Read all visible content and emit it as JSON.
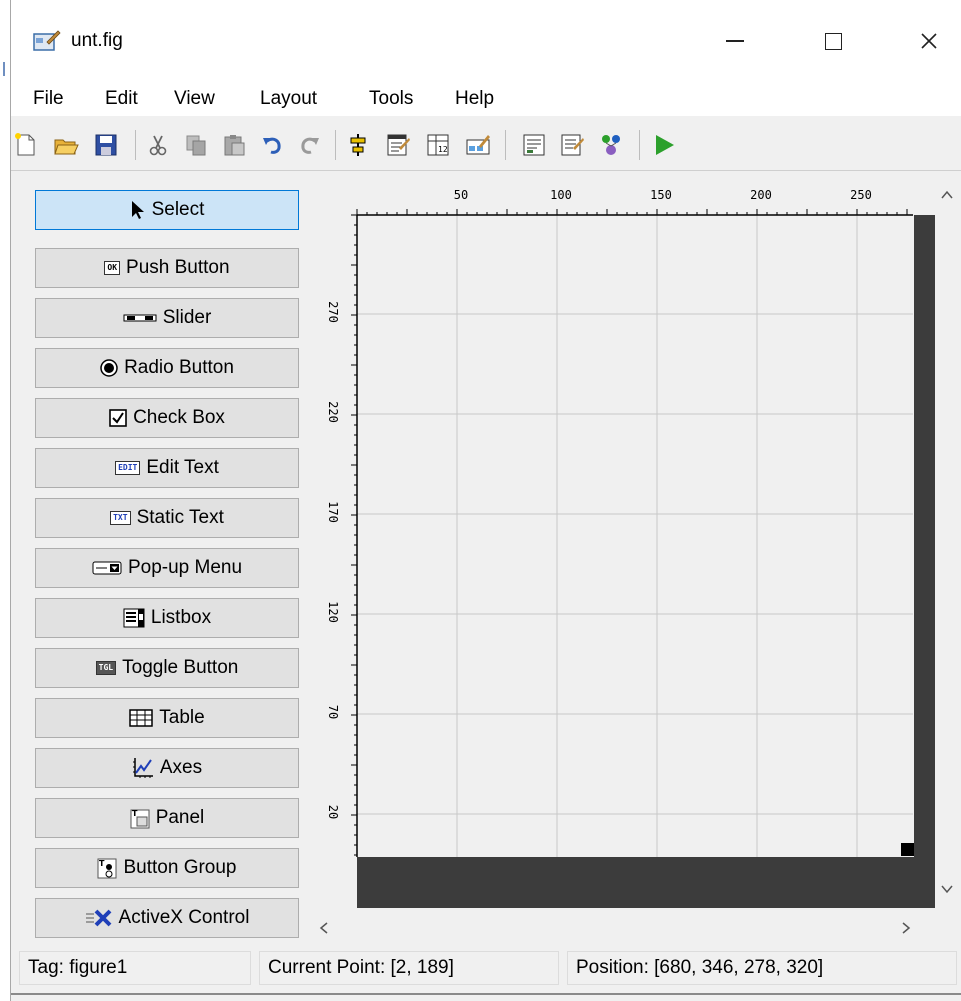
{
  "window": {
    "title": "unt.fig"
  },
  "menu": [
    "File",
    "Edit",
    "View",
    "Layout",
    "Tools",
    "Help"
  ],
  "toolbar": [
    "new-file-icon",
    "open-folder-icon",
    "save-icon",
    "cut-icon",
    "copy-icon",
    "paste-icon",
    "undo-icon",
    "redo-icon",
    "align-objects-icon",
    "menu-editor-icon",
    "tab-order-editor-icon",
    "toolbar-editor-icon",
    "editor-icon",
    "property-inspector-icon",
    "object-browser-icon",
    "run-figure-icon"
  ],
  "palette": {
    "selected": "Select",
    "items": [
      {
        "label": "Select",
        "icon": "arrow-cursor-icon"
      },
      {
        "label": "Push Button",
        "icon": "push-button-icon",
        "glyph": "OK"
      },
      {
        "label": "Slider",
        "icon": "slider-icon"
      },
      {
        "label": "Radio Button",
        "icon": "radio-button-icon"
      },
      {
        "label": "Check Box",
        "icon": "check-box-icon"
      },
      {
        "label": "Edit Text",
        "icon": "edit-text-icon",
        "glyph": "EDIT"
      },
      {
        "label": "Static Text",
        "icon": "static-text-icon",
        "glyph": "TXT"
      },
      {
        "label": "Pop-up Menu",
        "icon": "popup-menu-icon"
      },
      {
        "label": "Listbox",
        "icon": "listbox-icon"
      },
      {
        "label": "Toggle Button",
        "icon": "toggle-button-icon",
        "glyph": "TGL"
      },
      {
        "label": "Table",
        "icon": "table-icon"
      },
      {
        "label": "Axes",
        "icon": "axes-icon"
      },
      {
        "label": "Panel",
        "icon": "panel-icon"
      },
      {
        "label": "Button Group",
        "icon": "button-group-icon"
      },
      {
        "label": "ActiveX Control",
        "icon": "activex-control-icon"
      }
    ]
  },
  "ruler": {
    "x_labels": [
      "50",
      "100",
      "150",
      "200",
      "250"
    ],
    "y_labels": [
      "270",
      "220",
      "170",
      "120",
      "70",
      "20"
    ]
  },
  "colors": {
    "selected_bg": "#cce4f7",
    "selected_border": "#0078d7",
    "figure_dark": "#3c3c3c",
    "run_green": "#2ca02c"
  },
  "status": {
    "tag": "Tag: figure1",
    "current_point": "Current Point:  [2, 189]",
    "position": "Position: [680, 346, 278, 320]"
  }
}
